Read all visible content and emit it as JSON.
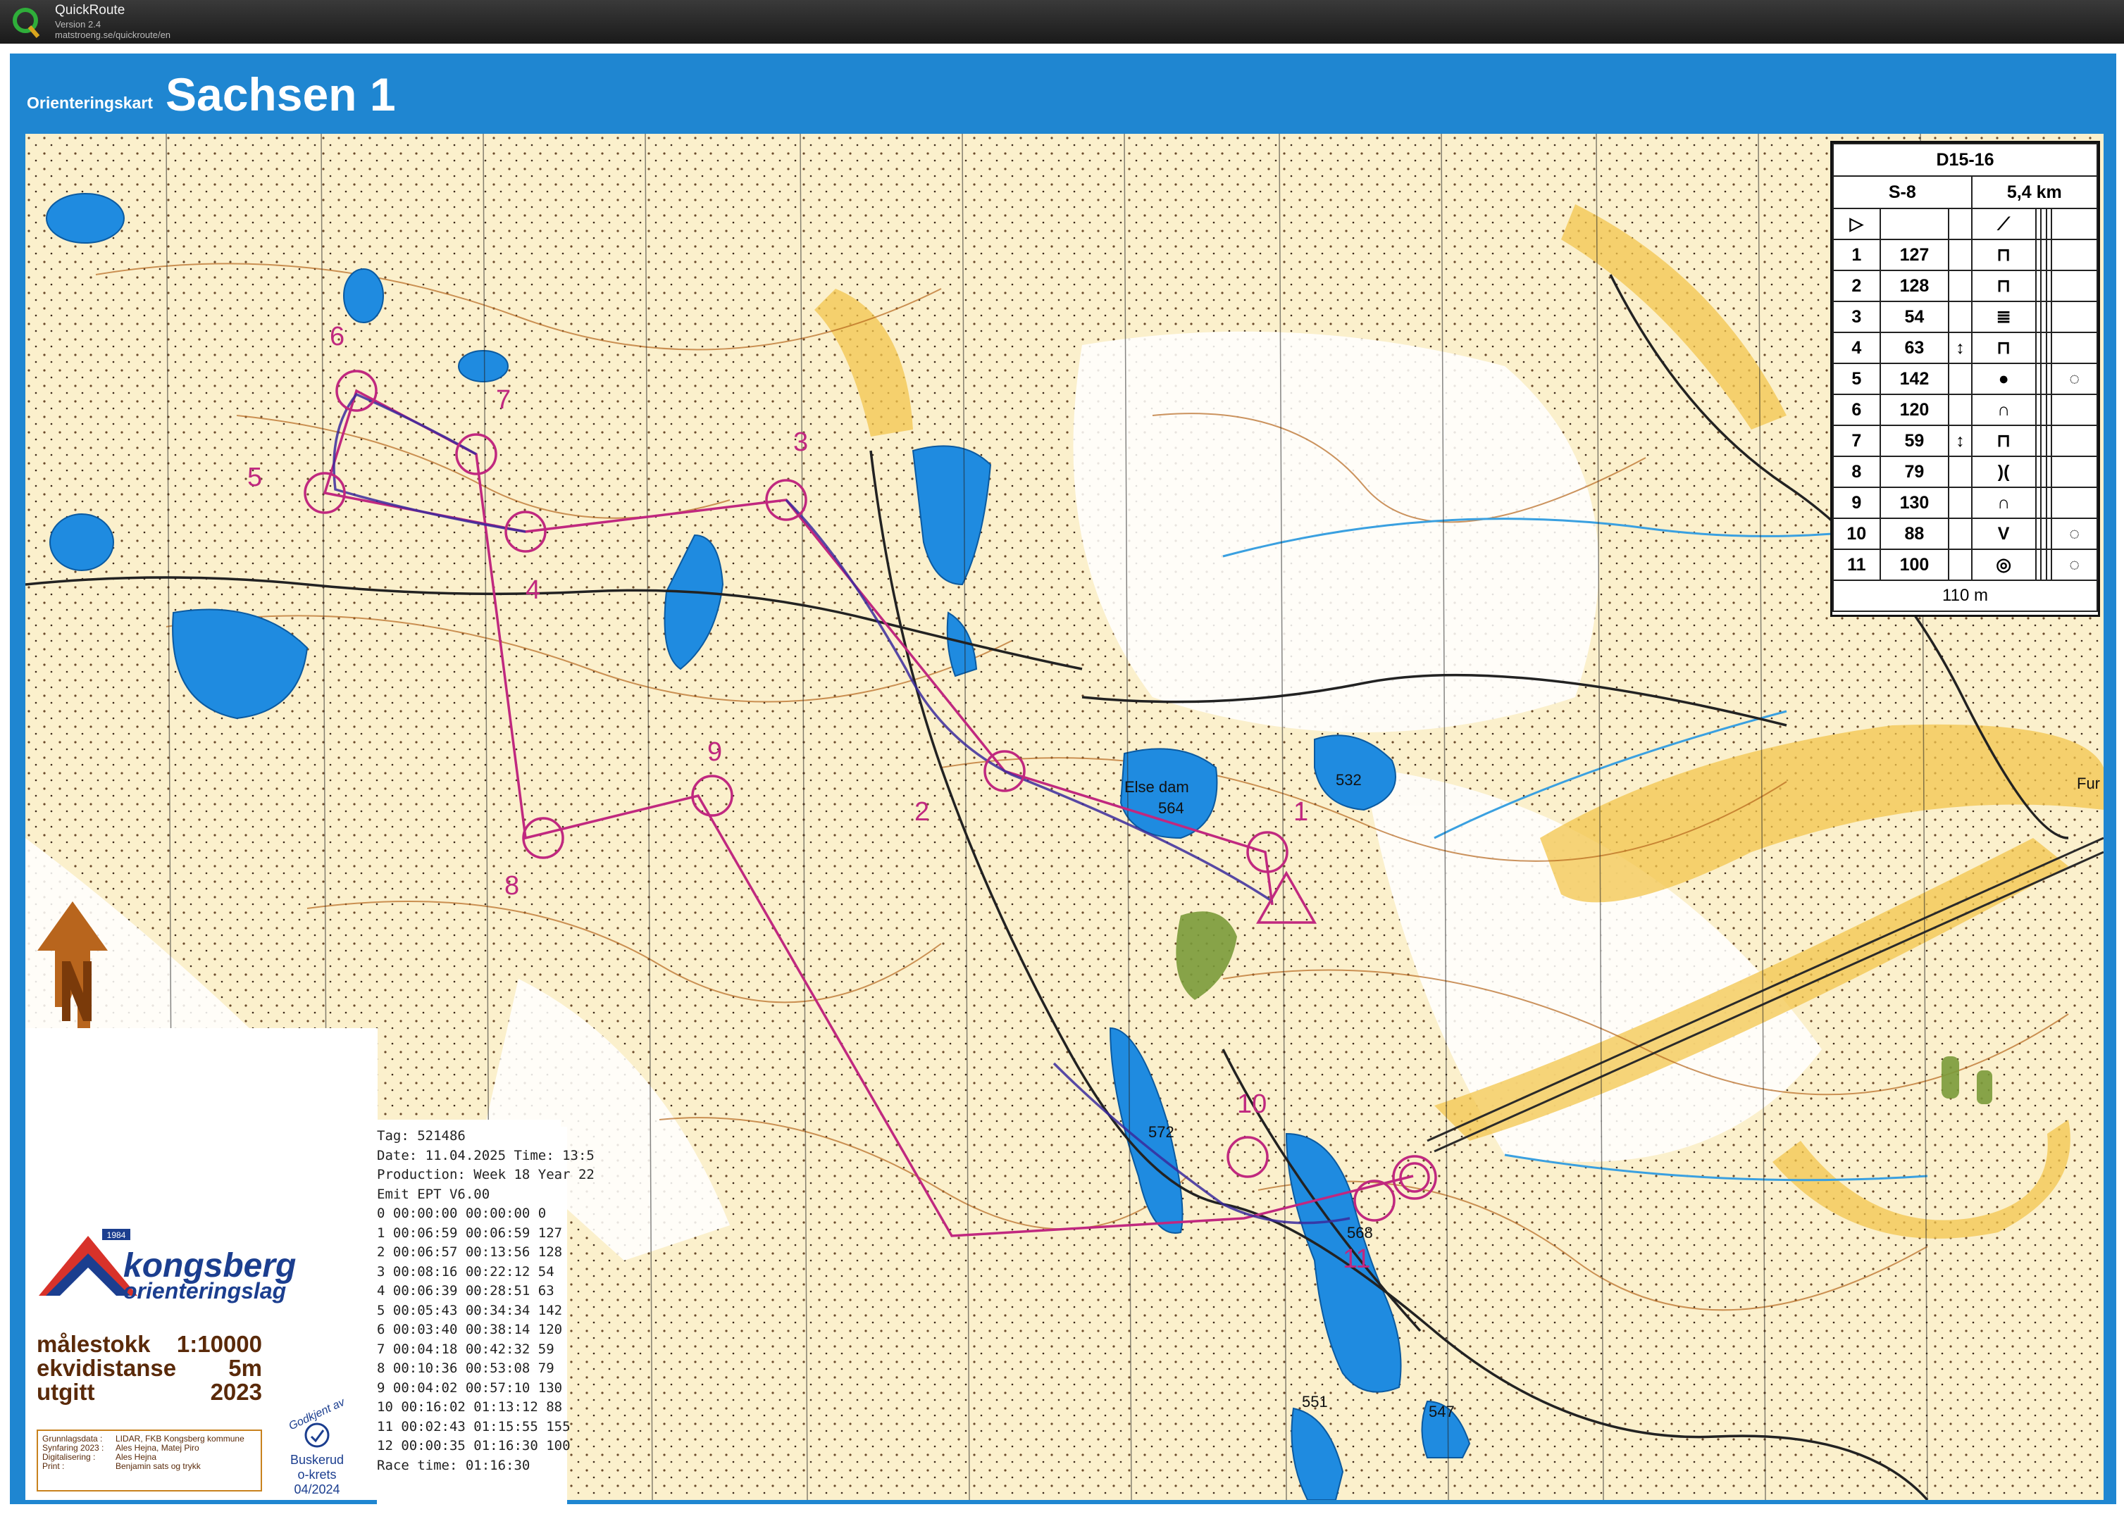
{
  "app": {
    "name": "QuickRoute",
    "version": "Version 2.4",
    "url": "matstroeng.se/quickroute/en"
  },
  "map": {
    "type_label": "Orienteringskart",
    "title": "Sachsen 1",
    "lake_labels": [
      "Else dam",
      "564",
      "532",
      "572",
      "568",
      "551",
      "547"
    ],
    "edge_label": "Fur",
    "control_numbers": [
      "1",
      "2",
      "3",
      "4",
      "5",
      "6",
      "7",
      "8",
      "9",
      "10",
      "11"
    ]
  },
  "legend": {
    "class": "D15-16",
    "course": "S-8",
    "length": "5,4 km",
    "controls": [
      {
        "n": "1",
        "code": "127"
      },
      {
        "n": "2",
        "code": "128"
      },
      {
        "n": "3",
        "code": "54"
      },
      {
        "n": "4",
        "code": "63"
      },
      {
        "n": "5",
        "code": "142"
      },
      {
        "n": "6",
        "code": "120"
      },
      {
        "n": "7",
        "code": "59"
      },
      {
        "n": "8",
        "code": "79"
      },
      {
        "n": "9",
        "code": "130"
      },
      {
        "n": "10",
        "code": "88"
      },
      {
        "n": "11",
        "code": "100"
      }
    ],
    "finish_distance": "110 m"
  },
  "receipt": {
    "lines": [
      "Tag: 521486",
      "Date: 11.04.2025 Time: 13:5",
      "Production: Week 18 Year 22",
      "Emit EPT V6.00",
      "0 00:00:00 00:00:00 0",
      "1 00:06:59 00:06:59 127",
      "2 00:06:57 00:13:56 128",
      "3 00:08:16 00:22:12 54",
      "4 00:06:39 00:28:51 63",
      "5 00:05:43 00:34:34 142",
      "6 00:03:40 00:38:14 120",
      "7 00:04:18 00:42:32 59",
      "8 00:10:36 00:53:08 79",
      "9 00:04:02 00:57:10 130",
      "10 00:16:02 01:13:12 88",
      "11 00:02:43 01:15:55 155",
      "12 00:00:35 01:16:30 100",
      "Race time: 01:16:30"
    ]
  },
  "club": {
    "year": "1984",
    "name_line1": "kongsberg",
    "name_line2": "orienteringslag"
  },
  "info": [
    {
      "k": "målestokk",
      "v": "1:10000"
    },
    {
      "k": "ekvidistanse",
      "v": "5m"
    },
    {
      "k": "utgitt",
      "v": "2023"
    }
  ],
  "credits": [
    {
      "k": "Grunnlagsdata :",
      "v": "LIDAR, FKB Kongsberg kommune"
    },
    {
      "k": "Synfaring 2023 :",
      "v": "Ales Hejna, Matej Piro"
    },
    {
      "k": "Digitalisering :",
      "v": "Ales Hejna"
    },
    {
      "k": "Print :",
      "v": "Benjamin sats og trykk"
    }
  ],
  "approval": {
    "stamp": "Godkjent av",
    "org1": "Buskerud",
    "org2": "o-krets",
    "date": "04/2024"
  },
  "colors": {
    "frame": "#1f86d1",
    "course": "#c0287f",
    "route": "#3a2a9c",
    "lake": "#1f8be0",
    "terrain": "#f6e7b8",
    "contour": "#b5651d"
  }
}
